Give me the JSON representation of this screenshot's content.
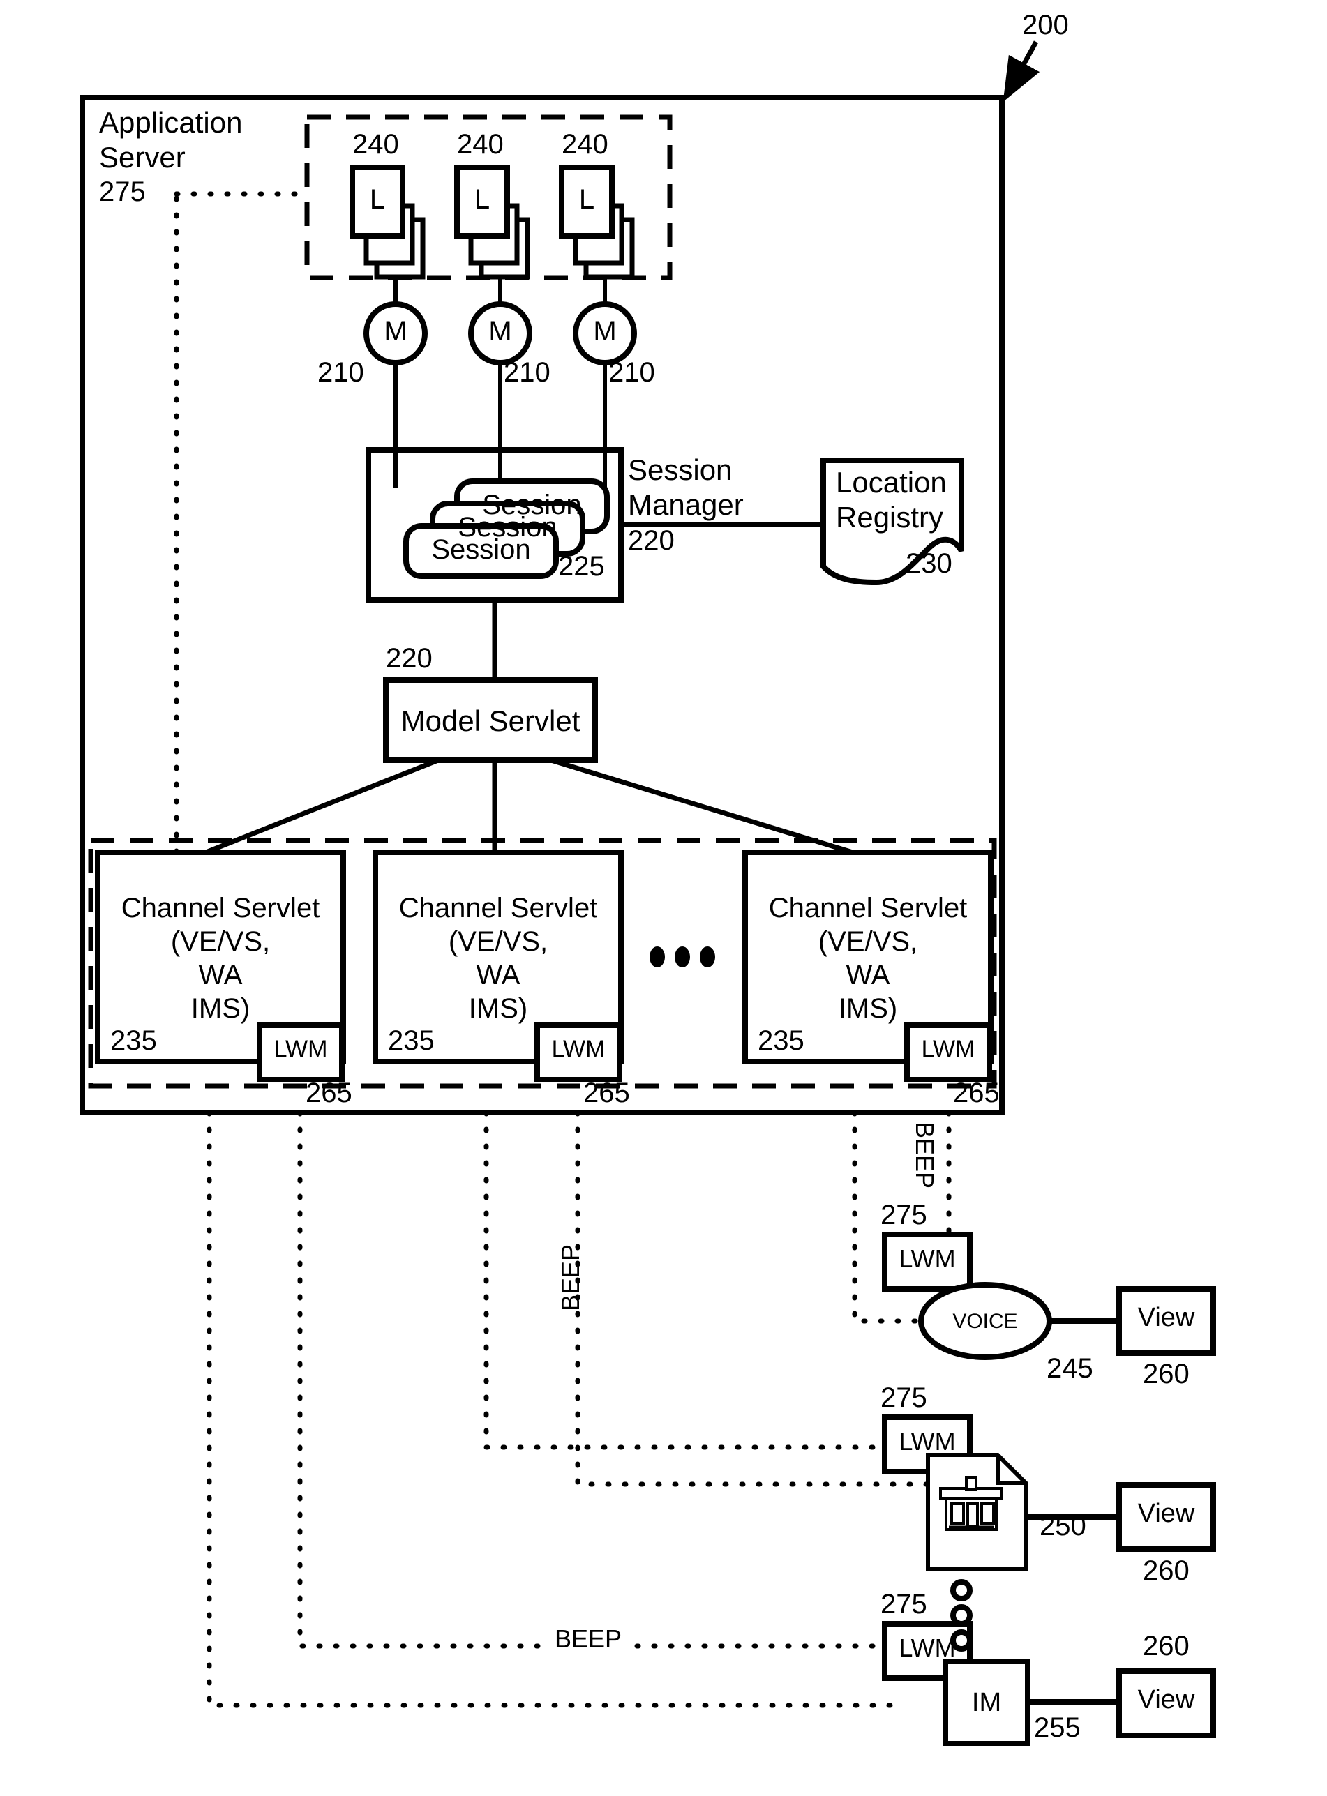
{
  "figure": {
    "ref_main": "200",
    "app_server_title_line1": "Application",
    "app_server_title_line2": "Server",
    "app_server_ref": "275"
  },
  "listeners": {
    "ref": "240",
    "glyph": "L",
    "stacks": [
      {
        "ref": "240",
        "glyph": "L"
      },
      {
        "ref": "240",
        "glyph": "L"
      },
      {
        "ref": "240",
        "glyph": "L"
      }
    ]
  },
  "models": [
    {
      "glyph": "M",
      "ref": "210"
    },
    {
      "glyph": "M",
      "ref": "210"
    },
    {
      "glyph": "M",
      "ref": "210"
    }
  ],
  "session_manager": {
    "label_line1": "Session",
    "label_line2": "Manager",
    "ref": "220",
    "session_label": "Session",
    "session_ref": "225",
    "sessions": [
      "Session",
      "Session",
      "Session"
    ]
  },
  "location_registry": {
    "label_line1": "Location",
    "label_line2": "Registry",
    "ref": "230"
  },
  "model_servlet": {
    "label": "Model Servlet",
    "ref": "220"
  },
  "channel_servlets": [
    {
      "line1": "Channel Servlet",
      "line2": "(VE/VS,",
      "line3": "WA",
      "line4": "IMS)",
      "ref": "235",
      "lwm_label": "LWM",
      "lwm_ref": "265"
    },
    {
      "line1": "Channel Servlet",
      "line2": "(VE/VS,",
      "line3": "WA",
      "line4": "IMS)",
      "ref": "235",
      "lwm_label": "LWM",
      "lwm_ref": "265"
    },
    {
      "line1": "Channel Servlet",
      "line2": "(VE/VS,",
      "line3": "WA",
      "line4": "IMS)",
      "ref": "235",
      "lwm_label": "LWM",
      "lwm_ref": "265"
    }
  ],
  "channel_ellipsis": "● ● ●",
  "clients": {
    "voice": {
      "lwm_label": "LWM",
      "lwm_ref": "275",
      "node_label": "VOICE",
      "node_ref": "245",
      "view_label": "View",
      "view_ref": "260",
      "beep_label": "BEEP"
    },
    "web": {
      "lwm_label": "LWM",
      "lwm_ref": "275",
      "node_ref": "250",
      "view_label": "View",
      "view_ref": "260",
      "beep_label": "BEEP",
      "icon": "browser-page-icon"
    },
    "im": {
      "lwm_label": "LWM",
      "lwm_ref": "275",
      "node_label": "IM",
      "node_ref": "255",
      "view_label": "View",
      "view_ref": "260",
      "beep_label": "BEEP"
    }
  },
  "vertical_ellipsis": "○○○"
}
